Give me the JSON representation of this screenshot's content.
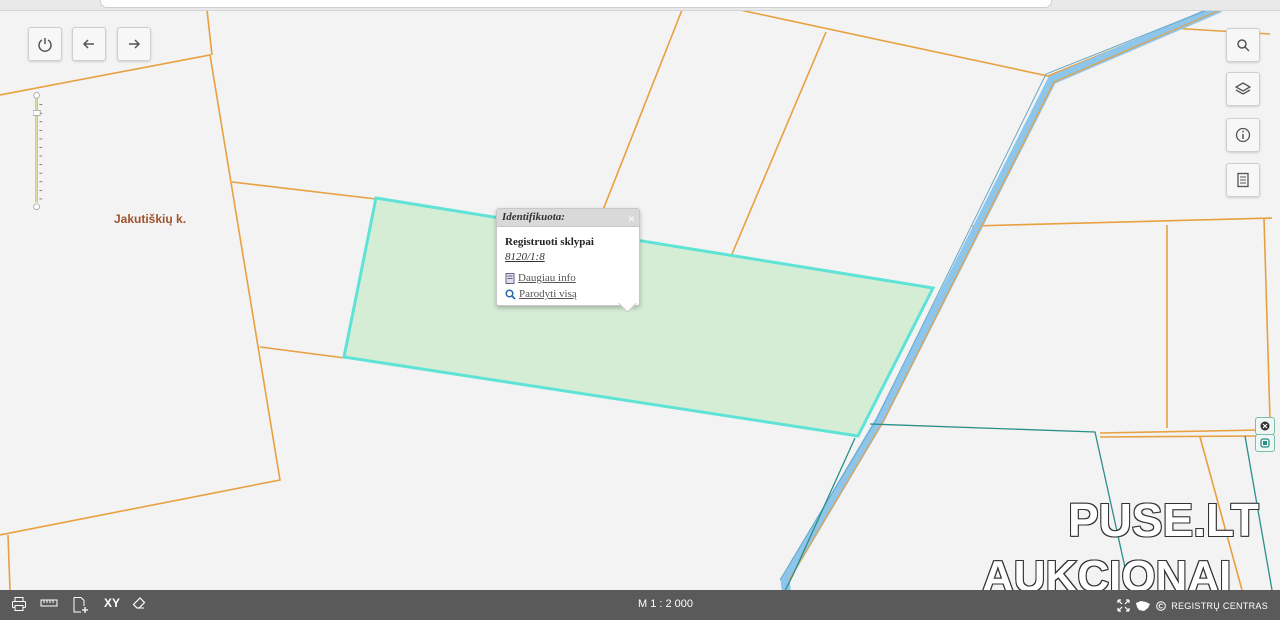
{
  "map": {
    "place_label": "Jakutiškių k.",
    "highlight_fill": "#d5edd5",
    "highlight_stroke": "#5fe3d6",
    "boundary_color": "#e8a040",
    "road_color": "#8ec5ea"
  },
  "popup": {
    "title": "Identifikuota:",
    "close_icon": "×",
    "layer_title": "Registruoti sklypai",
    "parcel_id": "8120/1:8",
    "more_info": "Daugiau info",
    "show_all": "Parodyti visą"
  },
  "toolbar_left": {
    "power": "power-icon",
    "back": "back-arrow-icon",
    "forward": "forward-arrow-icon"
  },
  "toolbar_right": [
    "search-icon",
    "layers-icon",
    "info-icon",
    "document-icon"
  ],
  "bottom": {
    "xy_label": "XY",
    "scale": "M 1 : 2 000",
    "registry": "REGISTRŲ CENTRAS"
  },
  "watermark": {
    "line1": "PUSE.LT",
    "line2": "AUKCIONAI"
  }
}
